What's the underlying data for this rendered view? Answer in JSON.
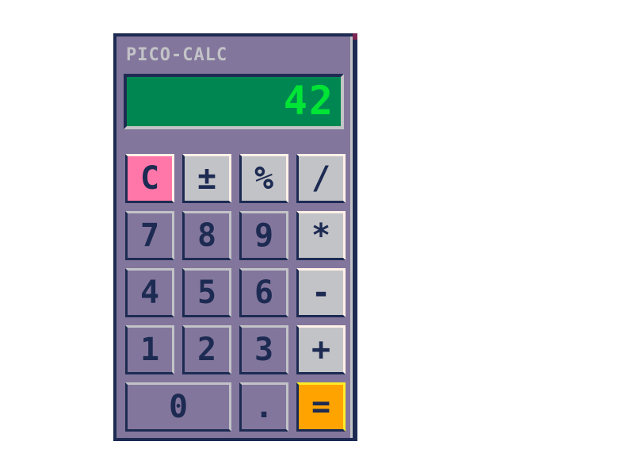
{
  "app": {
    "title": "PICO-CALC"
  },
  "display": {
    "value": "42"
  },
  "keys": {
    "clear": "C",
    "plus_minus": "±",
    "percent": "%",
    "divide": "/",
    "seven": "7",
    "eight": "8",
    "nine": "9",
    "multiply": "*",
    "four": "4",
    "five": "5",
    "six": "6",
    "minus": "-",
    "one": "1",
    "two": "2",
    "three": "3",
    "plus": "+",
    "zero": "0",
    "decimal": ".",
    "equals": "="
  },
  "colors": {
    "body": "#83769c",
    "frame": "#1d2b53",
    "display_bg": "#008751",
    "display_text": "#00e436",
    "clear_key": "#ff77a8",
    "function_key": "#c2c3c7",
    "equals_key": "#ffa300"
  }
}
